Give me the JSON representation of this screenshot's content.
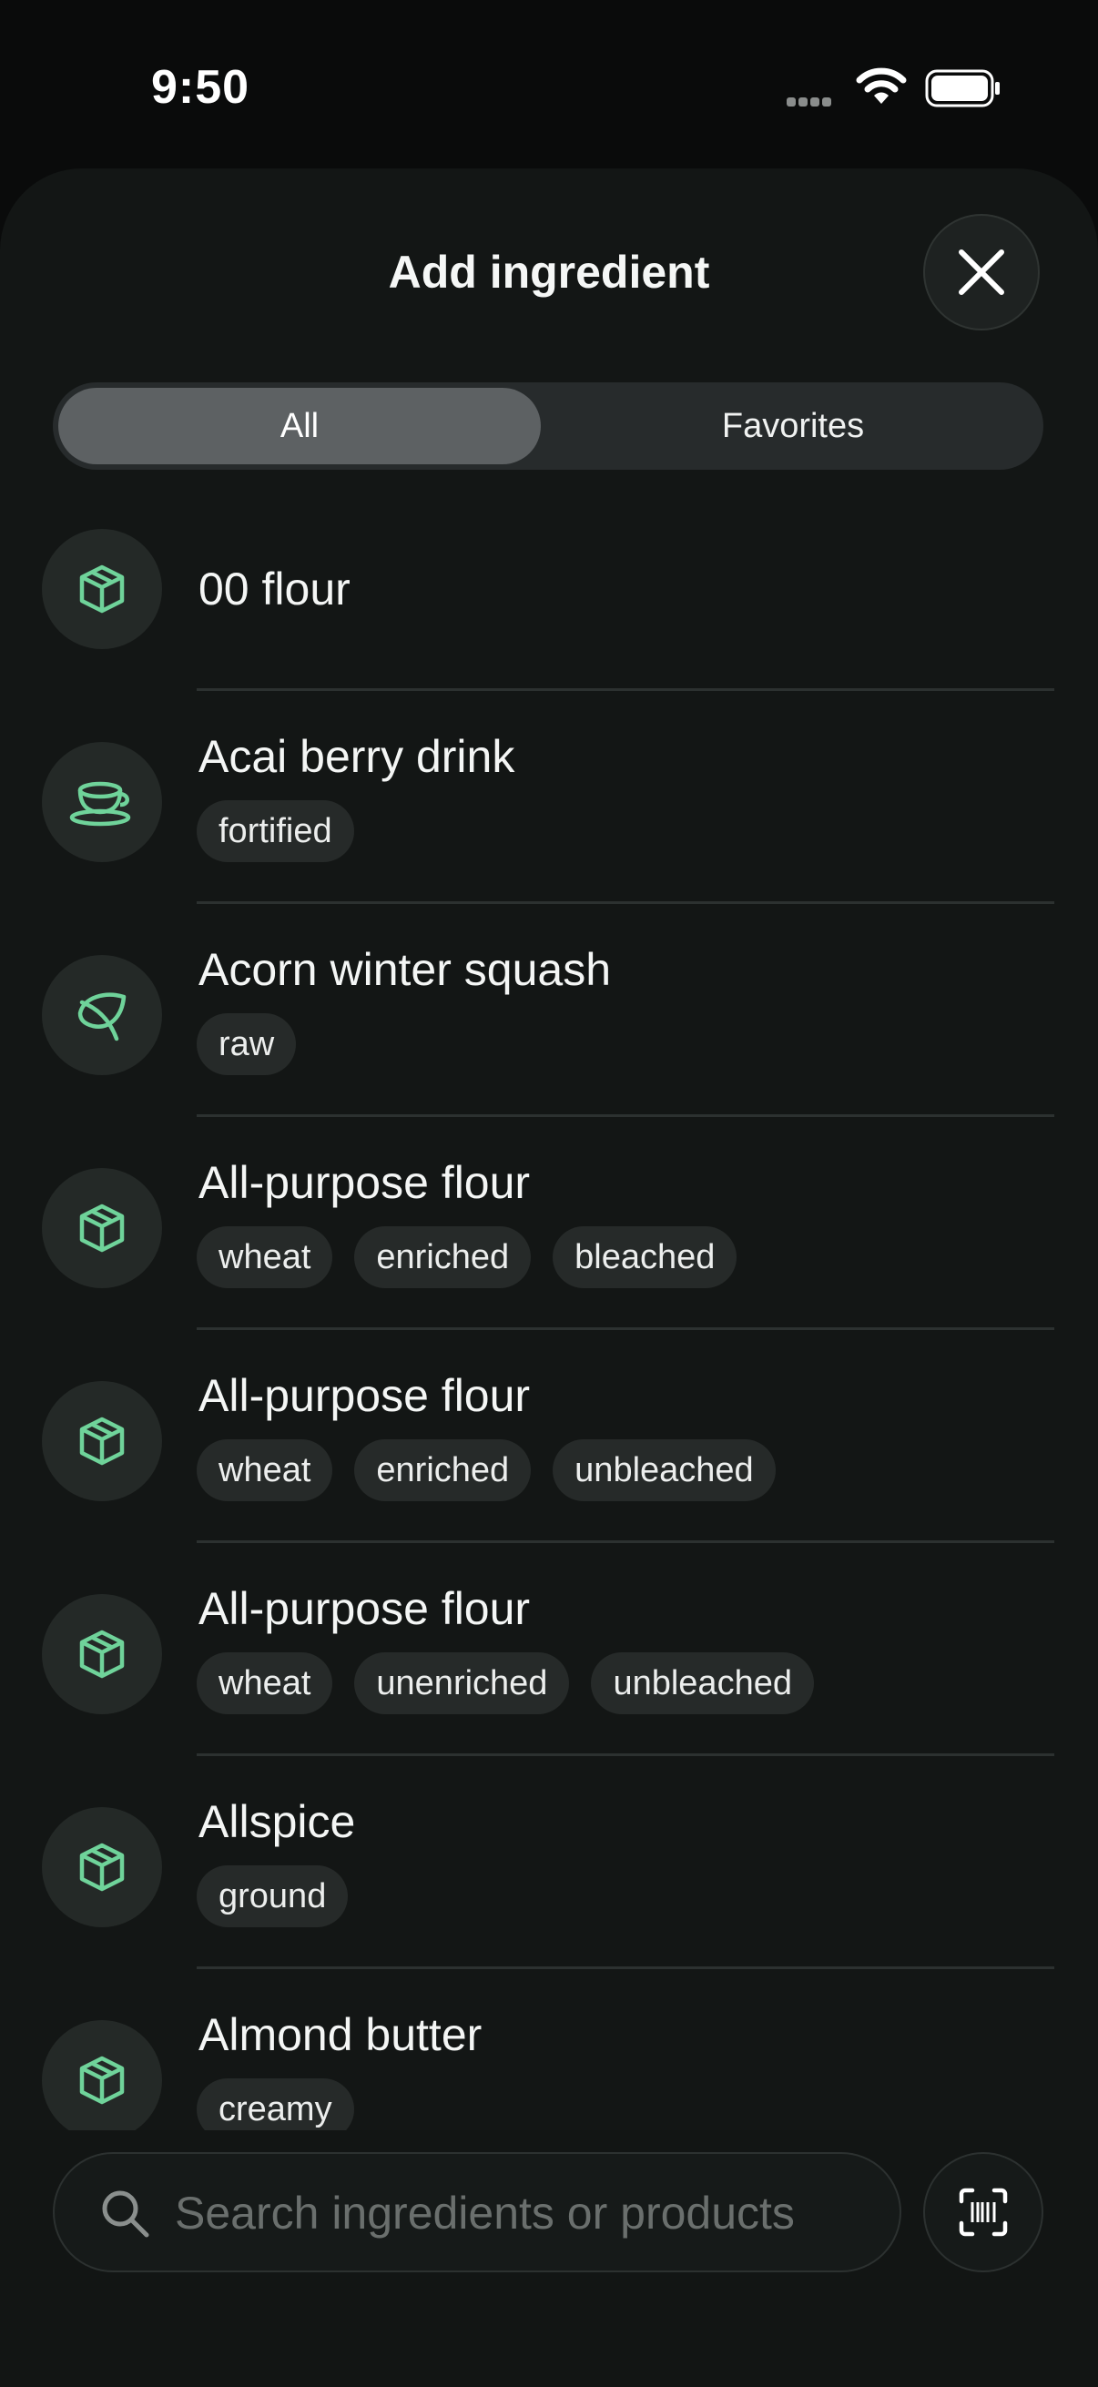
{
  "status_bar": {
    "time": "9:50"
  },
  "sheet": {
    "title": "Add ingredient"
  },
  "segments": [
    {
      "label": "All",
      "selected": true
    },
    {
      "label": "Favorites",
      "selected": false
    }
  ],
  "accent_color": "#6fd39a",
  "ingredients": [
    {
      "name": "00 flour",
      "icon": "box-icon",
      "tags": []
    },
    {
      "name": "Acai berry drink",
      "icon": "cup-icon",
      "tags": [
        "fortified"
      ]
    },
    {
      "name": "Acorn winter squash",
      "icon": "leaf-icon",
      "tags": [
        "raw"
      ]
    },
    {
      "name": "All-purpose flour",
      "icon": "box-icon",
      "tags": [
        "wheat",
        "enriched",
        "bleached"
      ]
    },
    {
      "name": "All-purpose flour",
      "icon": "box-icon",
      "tags": [
        "wheat",
        "enriched",
        "unbleached"
      ]
    },
    {
      "name": "All-purpose flour",
      "icon": "box-icon",
      "tags": [
        "wheat",
        "unenriched",
        "unbleached"
      ]
    },
    {
      "name": "Allspice",
      "icon": "box-icon",
      "tags": [
        "ground"
      ]
    },
    {
      "name": "Almond butter",
      "icon": "box-icon",
      "tags": [
        "creamy"
      ]
    }
  ],
  "search": {
    "placeholder": "Search ingredients or products",
    "value": ""
  }
}
